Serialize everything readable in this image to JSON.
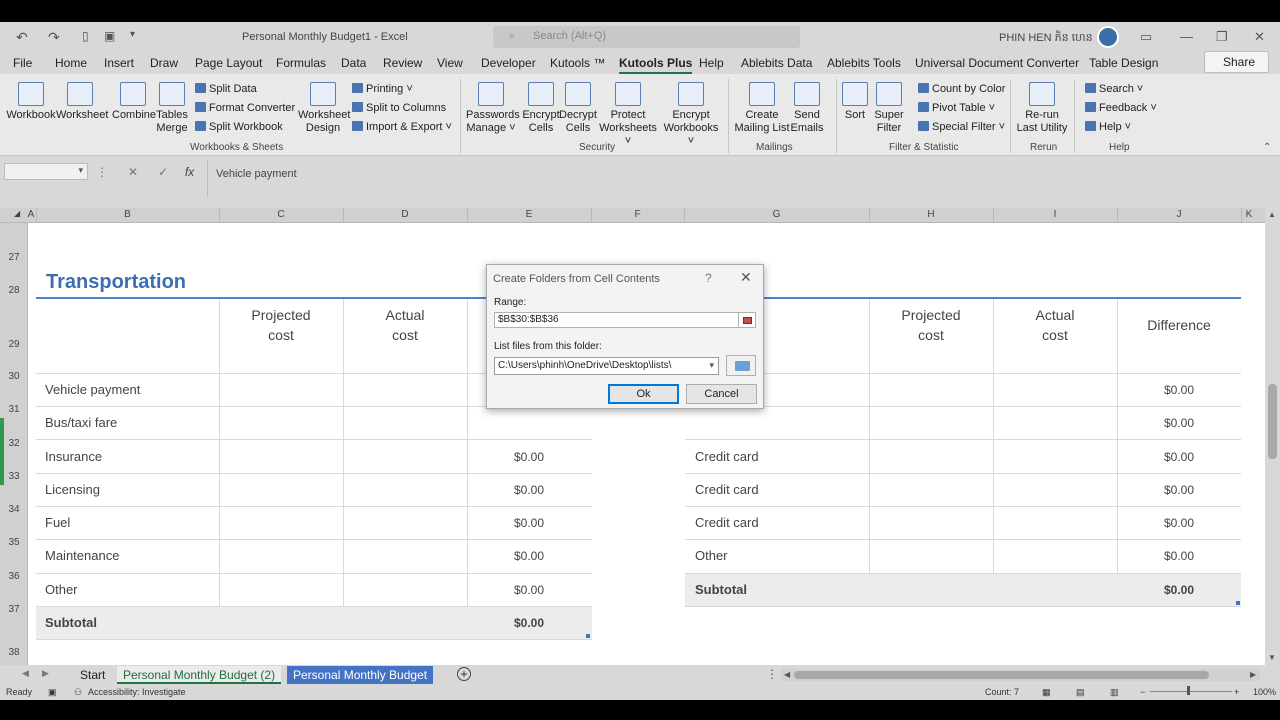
{
  "window": {
    "doc_title": "Personal Monthly Budget1  -  Excel",
    "search_placeholder": "Search (Alt+Q)",
    "user_name": "PHIN HEN ភិន ហេន"
  },
  "menu_tabs": [
    "File",
    "Home",
    "Insert",
    "Draw",
    "Page Layout",
    "Formulas",
    "Data",
    "Review",
    "View",
    "Developer",
    "Kutools ™",
    "Kutools Plus",
    "Help",
    "Ablebits Data",
    "Ablebits Tools",
    "Universal Document Converter",
    "Table Design"
  ],
  "share_label": "Share",
  "ribbon": {
    "workbook": "Workbook",
    "worksheet": "Worksheet",
    "combine": "Combine",
    "tables_merge_1": "Tables",
    "tables_merge_2": "Merge",
    "split_data": "Split Data",
    "format_converter": "Format Converter",
    "split_workbook": "Split Workbook",
    "worksheet_design_1": "Worksheet",
    "worksheet_design_2": "Design",
    "printing": "Printing ˅",
    "split_to_columns": "Split to Columns",
    "import_export": "Import & Export ˅",
    "group_workbooks": "Workbooks & Sheets",
    "passwords_manage_1": "Passwords",
    "passwords_manage_2": "Manage ˅",
    "encrypt_cells_1": "Encrypt",
    "encrypt_cells_2": "Cells",
    "decrypt_cells_1": "Decrypt",
    "decrypt_cells_2": "Cells",
    "protect_worksheets_1": "Protect",
    "protect_worksheets_2": "Worksheets ˅",
    "encrypt_workbooks_1": "Encrypt",
    "encrypt_workbooks_2": "Workbooks ˅",
    "group_security": "Security",
    "create_mailing_list_1": "Create",
    "create_mailing_list_2": "Mailing List",
    "send_emails_1": "Send",
    "send_emails_2": "Emails",
    "group_mailings": "Mailings",
    "sort": "Sort",
    "super_filter_1": "Super",
    "super_filter_2": "Filter",
    "count_by_color": "Count by Color",
    "pivot_table": "Pivot Table ˅",
    "special_filter": "Special Filter ˅",
    "group_filter": "Filter & Statistic",
    "rerun_1": "Re-run",
    "rerun_2": "Last Utility",
    "group_rerun": "Rerun",
    "search": "Search  ˅",
    "feedback": "Feedback ˅",
    "help": "Help ˅",
    "group_help": "Help"
  },
  "formula_bar": {
    "content": "Vehicle payment"
  },
  "columns": [
    "A",
    "B",
    "C",
    "D",
    "E",
    "F",
    "G",
    "H",
    "I",
    "J",
    "K"
  ],
  "rows": [
    "27",
    "28",
    "29",
    "30",
    "31",
    "32",
    "33",
    "34",
    "35",
    "36",
    "37",
    "38"
  ],
  "sheet": {
    "section_title": "Transportation",
    "projected_1": "Projected",
    "projected_2": "cost",
    "actual_1": "Actual",
    "actual_2": "cost",
    "difference": "Difference",
    "left_labels": [
      "Vehicle payment",
      "Bus/taxi fare",
      "Insurance",
      "Licensing",
      "Fuel",
      "Maintenance",
      "Other"
    ],
    "left_values": [
      "$0.00",
      "$0.00",
      "$0.00",
      "$0.00",
      "$0.00"
    ],
    "left_subtotal_label": "Subtotal",
    "left_subtotal_value": "$0.00",
    "right_labels": [
      "Credit card",
      "Credit card",
      "Credit card",
      "Other"
    ],
    "right_values": [
      "$0.00",
      "$0.00",
      "$0.00",
      "$0.00",
      "$0.00",
      "$0.00"
    ],
    "right_subtotal_label": "Subtotal",
    "right_subtotal_value": "$0.00"
  },
  "sheet_tabs": [
    "Start",
    "Personal Monthly Budget (2)",
    "Personal Monthly Budget"
  ],
  "status": {
    "ready": "Ready",
    "accessibility": "Accessibility: Investigate",
    "count": "Count: 7",
    "zoom": "100%"
  },
  "dialog": {
    "title": "Create Folders from Cell Contents",
    "help": "?",
    "range_label": "Range:",
    "range_value": "$B$30:$B$36",
    "folder_label": "List files from this folder:",
    "folder_value": "C:\\Users\\phinh\\OneDrive\\Desktop\\lists\\",
    "ok": "Ok",
    "cancel": "Cancel"
  }
}
